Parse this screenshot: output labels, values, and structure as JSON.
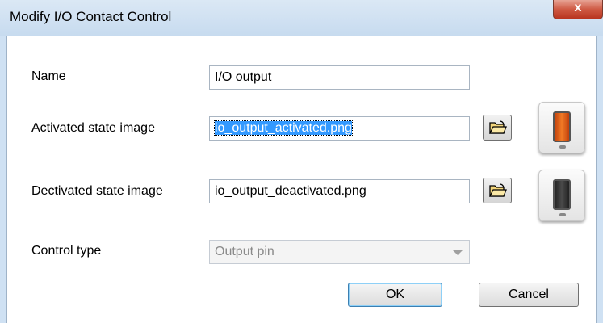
{
  "dialog": {
    "title": "Modify I/O Contact Control",
    "close_glyph": "x"
  },
  "form": {
    "name_label": "Name",
    "name_value": "I/O output",
    "activated_label": "Activated state image",
    "activated_value": "io_output_activated.png",
    "deactivated_label": "Dectivated state image",
    "deactivated_value": "io_output_deactivated.png",
    "control_type_label": "Control type",
    "control_type_value": "Output pin"
  },
  "icons": {
    "browse": "open-folder-icon",
    "activated_preview": "switch-on-orange-icon",
    "deactivated_preview": "switch-off-dark-icon"
  },
  "colors": {
    "activated_switch": "#e8651c",
    "deactivated_switch": "#3a3a3a",
    "selection": "#3399ff"
  },
  "buttons": {
    "ok": "OK",
    "cancel": "Cancel"
  }
}
